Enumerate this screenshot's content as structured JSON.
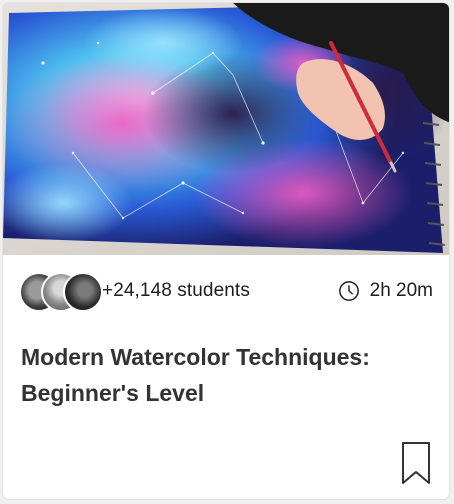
{
  "card": {
    "student_count": "+24,148 students",
    "duration": "2h 20m",
    "title": "Modern Watercolor Techniques: Beginner's Level"
  },
  "icons": {
    "clock": "clock-icon",
    "bookmark": "bookmark-icon",
    "avatars": [
      "avatar",
      "avatar",
      "avatar"
    ]
  },
  "colors": {
    "text": "#1e1e1e",
    "title": "#333333",
    "card_bg": "#ffffff",
    "border": "#e3e3e3"
  }
}
